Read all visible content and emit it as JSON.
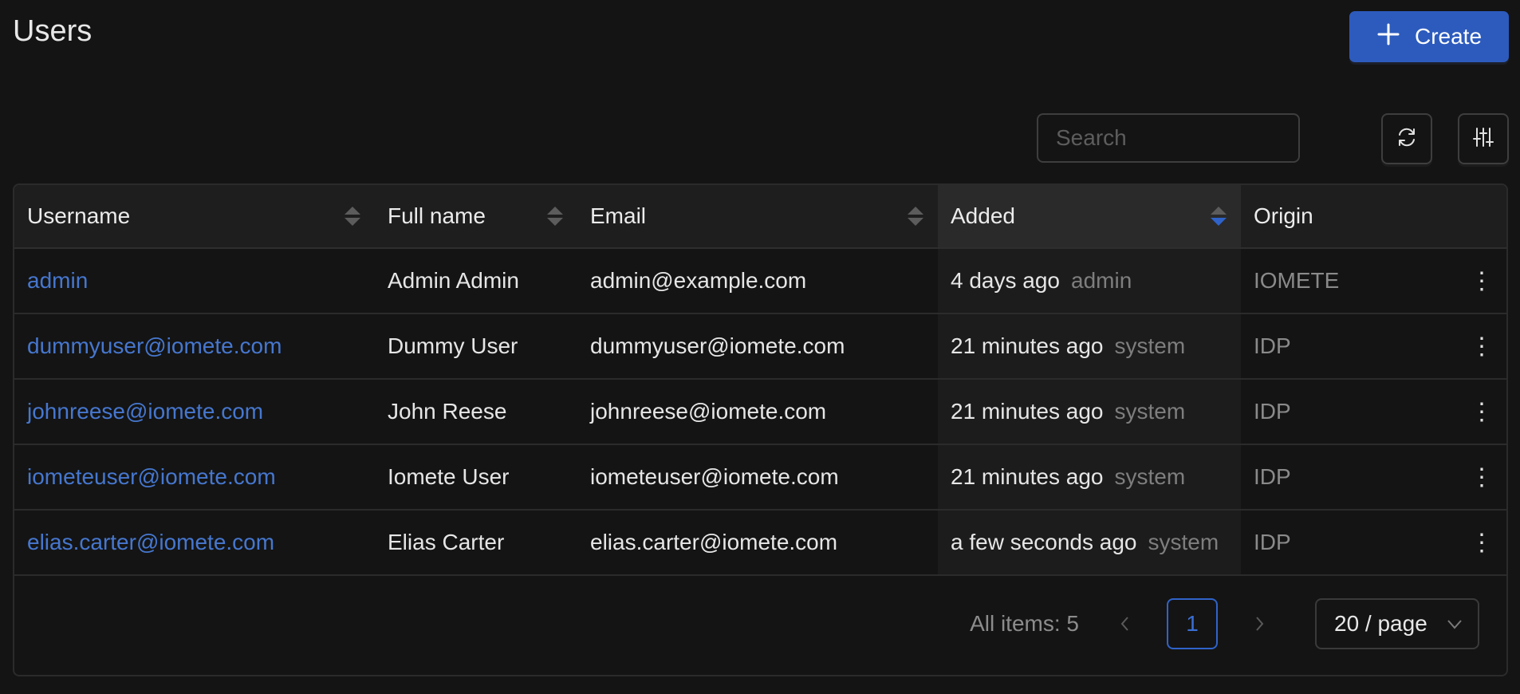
{
  "header": {
    "title": "Users",
    "create_label": "Create"
  },
  "toolbar": {
    "search_placeholder": "Search",
    "search_value": ""
  },
  "table": {
    "columns": [
      {
        "label": "Username",
        "sortable": true,
        "sort": "none"
      },
      {
        "label": "Full name",
        "sortable": true,
        "sort": "none"
      },
      {
        "label": "Email",
        "sortable": true,
        "sort": "none"
      },
      {
        "label": "Added",
        "sortable": true,
        "sort": "descending"
      },
      {
        "label": "Origin",
        "sortable": false
      }
    ],
    "rows": [
      {
        "username": "admin",
        "full_name": "Admin Admin",
        "email": "admin@example.com",
        "added": "4 days ago",
        "added_by": "admin",
        "origin": "IOMETE"
      },
      {
        "username": "dummyuser@iomete.com",
        "full_name": "Dummy User",
        "email": "dummyuser@iomete.com",
        "added": "21 minutes ago",
        "added_by": "system",
        "origin": "IDP"
      },
      {
        "username": "johnreese@iomete.com",
        "full_name": "John Reese",
        "email": "johnreese@iomete.com",
        "added": "21 minutes ago",
        "added_by": "system",
        "origin": "IDP"
      },
      {
        "username": "iometeuser@iomete.com",
        "full_name": "Iomete User",
        "email": "iometeuser@iomete.com",
        "added": "21 minutes ago",
        "added_by": "system",
        "origin": "IDP"
      },
      {
        "username": "elias.carter@iomete.com",
        "full_name": "Elias Carter",
        "email": "elias.carter@iomete.com",
        "added": "a few seconds ago",
        "added_by": "system",
        "origin": "IDP"
      }
    ]
  },
  "pagination": {
    "total_label": "All items: 5",
    "current_page": "1",
    "page_size": "20 / page"
  },
  "colors": {
    "accent": "#2d5bbd",
    "link": "#4677cf",
    "background": "#141414"
  }
}
